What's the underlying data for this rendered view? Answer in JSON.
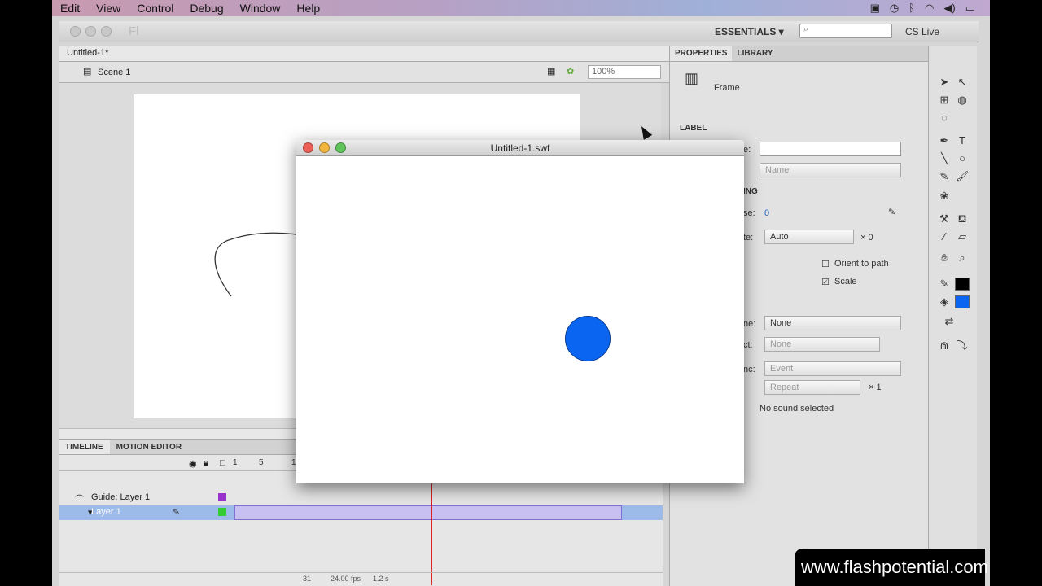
{
  "menubar": {
    "items": [
      "Edit",
      "View",
      "Control",
      "Debug",
      "Window",
      "Help"
    ]
  },
  "appbar": {
    "logo": "Fl",
    "workspace": "ESSENTIALS ▾",
    "cs_live": "CS Live"
  },
  "document": {
    "tab_title": "Untitled-1*",
    "scene": "Scene 1",
    "zoom": "100%"
  },
  "timeline": {
    "tabs": [
      "TIMELINE",
      "MOTION EDITOR"
    ],
    "frame_numbers": [
      "1",
      "5",
      "1"
    ],
    "layers": [
      {
        "name": "Guide: Layer 1"
      },
      {
        "name": "Layer 1"
      }
    ],
    "status": {
      "current_frame": "31",
      "fps": "24.00 fps",
      "time": "1.2 s"
    }
  },
  "properties": {
    "tabs": [
      "PROPERTIES",
      "LIBRARY"
    ],
    "type": "Frame",
    "section_label": "LABEL",
    "name_label": "e:",
    "label_type": "Name",
    "tweening_section": "ING",
    "ease_label": "se:",
    "ease_value": "0",
    "rotate_label": "te:",
    "rotate_value": "Auto",
    "rotate_x": "× 0",
    "orient_to_path": "Orient to path",
    "scale": "Scale",
    "sound_name_label": "ne:",
    "sound_name": "None",
    "effect_label": "ct:",
    "effect": "None",
    "sync_label": "nc:",
    "sync": "Event",
    "repeat": "Repeat",
    "repeat_x": "× 1",
    "no_sound": "No sound selected"
  },
  "swf_window": {
    "title": "Untitled-1.swf"
  },
  "watermark": "www.flashpotential.com",
  "colors": {
    "ball": "#0a66f0",
    "stroke_swatch": "#000000",
    "fill_swatch": "#0a66f0"
  }
}
